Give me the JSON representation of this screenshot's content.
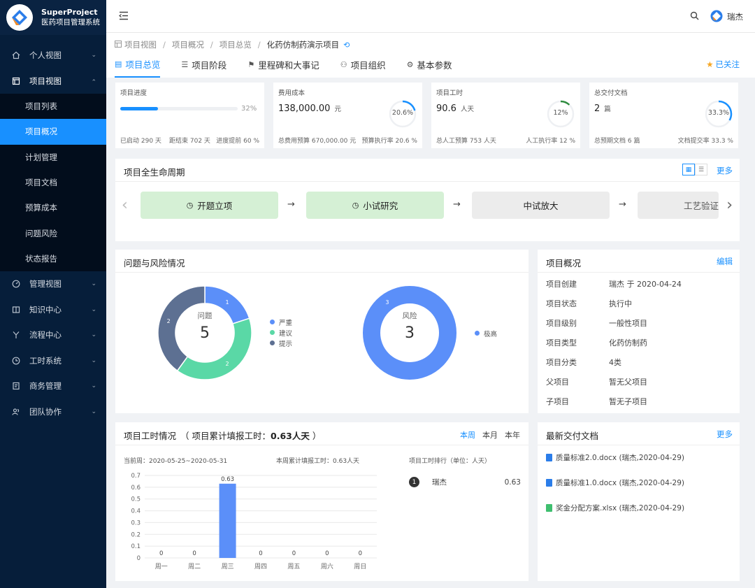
{
  "brand": {
    "name": "SuperProject",
    "subtitle": "医药项目管理系统"
  },
  "sidebar": {
    "items": [
      {
        "label": "个人视图",
        "icon": "home-icon",
        "chevron": "⌄"
      },
      {
        "label": "项目视图",
        "icon": "project-icon",
        "chevron": "⌃"
      },
      {
        "label": "管理视图",
        "icon": "dashboard-icon",
        "chevron": "⌄"
      },
      {
        "label": "知识中心",
        "icon": "book-icon",
        "chevron": "⌄"
      },
      {
        "label": "流程中心",
        "icon": "flow-icon",
        "chevron": "⌄"
      },
      {
        "label": "工时系统",
        "icon": "clock-icon",
        "chevron": "⌄"
      },
      {
        "label": "商务管理",
        "icon": "contract-icon",
        "chevron": "⌄"
      },
      {
        "label": "团队协作",
        "icon": "team-icon",
        "chevron": "⌄"
      }
    ],
    "subitems": [
      "项目列表",
      "项目概况",
      "计划管理",
      "项目文档",
      "预算成本",
      "问题风险",
      "状态报告"
    ],
    "active_sub": "项目概况"
  },
  "topbar": {
    "user": "瑞杰"
  },
  "breadcrumb": [
    "项目视图",
    "项目概况",
    "项目总览",
    "化药仿制药演示项目"
  ],
  "tabs": [
    "项目总览",
    "项目阶段",
    "里程碑和大事记",
    "项目组织",
    "基本参数"
  ],
  "follow_label": "已关注",
  "stats": {
    "progress": {
      "label": "项目进度",
      "percent": 32,
      "percent_text": "32%",
      "started": "已启动 290 天",
      "remaining": "距结束 702 天",
      "ahead": "进度提前 60 %"
    },
    "cost": {
      "label": "费用成本",
      "value": "138,000.00",
      "unit": "元",
      "ring_percent": 20.6,
      "ring_text": "20.6%",
      "budget": "总费用预算 670,000.00 元",
      "rate": "预算执行率 20.6 %"
    },
    "hours": {
      "label": "项目工时",
      "value": "90.6",
      "unit": "人天",
      "ring_percent": 12,
      "ring_text": "12%",
      "budget": "总人工预算 753 人天",
      "rate": "人工执行率 12 %"
    },
    "docs": {
      "label": "总交付文档",
      "value": "2",
      "unit": "篇",
      "ring_percent": 33.3,
      "ring_text": "33.3%",
      "budget": "总预期文档 6 篇",
      "rate": "文档提交率 33.3 %"
    }
  },
  "lifecycle": {
    "title": "项目全生命周期",
    "more": "更多",
    "stages": [
      {
        "label": "开题立项",
        "status": "done"
      },
      {
        "label": "小试研究",
        "status": "done"
      },
      {
        "label": "中试放大",
        "status": "todo"
      },
      {
        "label": "工艺验证",
        "status": "todo"
      }
    ]
  },
  "issues": {
    "title": "问题与风险情况",
    "issue_chart": {
      "center_label": "问题",
      "total": "5",
      "legend": [
        "严重",
        "建议",
        "提示"
      ],
      "values": [
        1,
        2,
        2
      ]
    },
    "risk_chart": {
      "center_label": "风险",
      "total": "3",
      "legend": [
        "极高"
      ],
      "values": [
        3
      ]
    },
    "colors": {
      "blue": "#5b8ff9",
      "green": "#5ad8a6",
      "gray": "#5d7092"
    }
  },
  "overview": {
    "title": "项目概况",
    "edit": "编辑",
    "rows": [
      {
        "k": "项目创建",
        "v": "瑞杰 于 2020-04-24"
      },
      {
        "k": "项目状态",
        "v": "执行中"
      },
      {
        "k": "项目级别",
        "v": "一般性项目"
      },
      {
        "k": "项目类型",
        "v": "化药仿制药"
      },
      {
        "k": "项目分类",
        "v": "4类"
      },
      {
        "k": "父项目",
        "v": "暂无父项目"
      },
      {
        "k": "子项目",
        "v": "暂无子项目"
      }
    ]
  },
  "workhours": {
    "title": "项目工时情况",
    "subtitle_prefix": "（ 项目累计填报工时：",
    "subtitle_value": "0.63人天",
    "subtitle_suffix": " ）",
    "periods": [
      "本周",
      "本月",
      "本年"
    ],
    "current_week": "当前周：2020-05-25~2020-05-31",
    "week_total": "本周累计填报工时：0.63人天",
    "ranking_title": "项目工时排行（单位：人天）",
    "ranking": [
      {
        "rank": "1",
        "name": "瑞杰",
        "value": "0.63"
      }
    ]
  },
  "chart_data": {
    "type": "bar",
    "categories": [
      "周一",
      "周二",
      "周三",
      "周四",
      "周五",
      "周六",
      "周日"
    ],
    "values": [
      0,
      0,
      0.63,
      0,
      0,
      0,
      0
    ],
    "data_labels": [
      "0",
      "0",
      "0.63",
      "0",
      "0",
      "0",
      "0"
    ],
    "yticks": [
      "0",
      "0.1",
      "0.2",
      "0.3",
      "0.4",
      "0.5",
      "0.6",
      "0.7"
    ],
    "ylim": [
      0,
      0.7
    ],
    "color": "#5b8ff9",
    "grid": true
  },
  "docs": {
    "title": "最新交付文档",
    "more": "更多",
    "items": [
      {
        "label": "质量标准2.0.docx (瑞杰,2020-04-29)",
        "type": "word"
      },
      {
        "label": "质量标准1.0.docx (瑞杰,2020-04-29)",
        "type": "word"
      },
      {
        "label": "奖金分配方案.xlsx (瑞杰,2020-04-29)",
        "type": "excel"
      }
    ]
  }
}
